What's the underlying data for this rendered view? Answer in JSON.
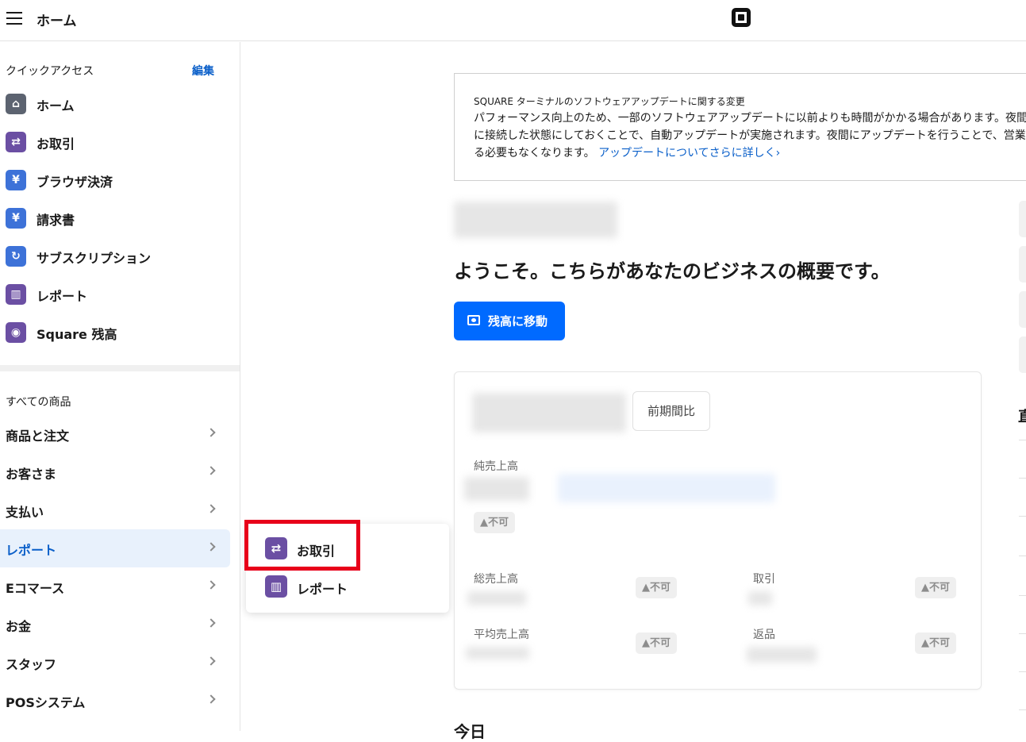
{
  "topbar": {
    "title": "ホーム"
  },
  "quick_access": {
    "heading": "クイックアクセス",
    "edit": "編集",
    "items": [
      {
        "label": "ホーム",
        "icon": "home-icon",
        "color": "#5c6370"
      },
      {
        "label": "お取引",
        "icon": "transactions-icon",
        "color": "#6b4fa3"
      },
      {
        "label": "ブラウザ決済",
        "icon": "yen-icon",
        "color": "#3d72d8"
      },
      {
        "label": "請求書",
        "icon": "invoice-icon",
        "color": "#3d72d8"
      },
      {
        "label": "サブスクリプション",
        "icon": "refresh-icon",
        "color": "#3d72d8"
      },
      {
        "label": "レポート",
        "icon": "bar-chart-icon",
        "color": "#6b4fa3"
      },
      {
        "label": "Square 残高",
        "icon": "cash-icon",
        "color": "#6b4fa3"
      }
    ]
  },
  "categories": {
    "heading": "すべての商品",
    "items": [
      {
        "label": "商品と注文"
      },
      {
        "label": "お客さま"
      },
      {
        "label": "支払い"
      },
      {
        "label": "レポート",
        "active": true
      },
      {
        "label": "Eコマース"
      },
      {
        "label": "お金"
      },
      {
        "label": "スタッフ"
      },
      {
        "label": "POSシステム"
      }
    ]
  },
  "flyout": {
    "items": [
      {
        "label": "お取引",
        "icon": "transactions-icon"
      },
      {
        "label": "レポート",
        "icon": "bar-chart-icon"
      }
    ]
  },
  "notice": {
    "title": "SQUARE ターミナルのソフトウェアアップデートに関する変更",
    "body": "パフォーマンス向上のため、一部のソフトウェアアップデートに以前よりも時間がかかる場合があります。夜間\nに接続した状態にしておくことで、自動アップデートが実施されます。夜間にアップデートを行うことで、営業\nる必要もなくなります。",
    "link": "アップデートについてさらに詳しく›"
  },
  "welcome": "ようこそ。こちらがあなたのビジネスの概要です。",
  "cta": {
    "label": "残高に移動"
  },
  "summary": {
    "compare_label": "前期間比",
    "net_sales_label": "純売上高",
    "gross_sales_label": "総売上高",
    "transactions_label": "取引",
    "avg_sales_label": "平均売上高",
    "refunds_label": "返品",
    "na": "▲不可"
  },
  "today_heading": "今日",
  "right_heading": "直"
}
